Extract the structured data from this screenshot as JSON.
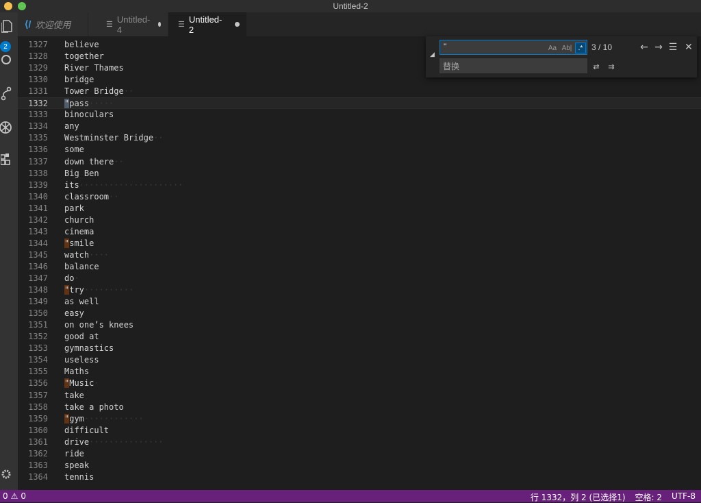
{
  "window": {
    "title": "Untitled-2"
  },
  "activity_bar": {
    "badge_count": "2"
  },
  "tabs": [
    {
      "label": "欢迎使用",
      "active": false
    },
    {
      "label": "Untitled-4",
      "active": false
    },
    {
      "label": "Untitled-2",
      "active": true
    }
  ],
  "editor": {
    "lines": [
      {
        "n": "1327",
        "text": "believe",
        "q": false,
        "ws": ""
      },
      {
        "n": "1328",
        "text": "together",
        "q": false,
        "ws": ""
      },
      {
        "n": "1329",
        "text": "River Thames",
        "q": false,
        "ws": ""
      },
      {
        "n": "1330",
        "text": "bridge",
        "q": false,
        "ws": ""
      },
      {
        "n": "1331",
        "text": "Tower Bridge",
        "q": false,
        "ws": "··"
      },
      {
        "n": "1332",
        "text": "pass",
        "q": true,
        "ws": "·····"
      },
      {
        "n": "1333",
        "text": "binoculars",
        "q": false,
        "ws": ""
      },
      {
        "n": "1334",
        "text": "any",
        "q": false,
        "ws": ""
      },
      {
        "n": "1335",
        "text": "Westminster Bridge",
        "q": false,
        "ws": "··"
      },
      {
        "n": "1336",
        "text": "some",
        "q": false,
        "ws": ""
      },
      {
        "n": "1337",
        "text": "down there",
        "q": false,
        "ws": "··"
      },
      {
        "n": "1338",
        "text": "Big Ben",
        "q": false,
        "ws": ""
      },
      {
        "n": "1339",
        "text": "its",
        "q": false,
        "ws": "·····················"
      },
      {
        "n": "1340",
        "text": "classroom",
        "q": false,
        "ws": "··"
      },
      {
        "n": "1341",
        "text": "park",
        "q": false,
        "ws": ""
      },
      {
        "n": "1342",
        "text": "church",
        "q": false,
        "ws": ""
      },
      {
        "n": "1343",
        "text": "cinema",
        "q": false,
        "ws": ""
      },
      {
        "n": "1344",
        "text": "smile",
        "q": true,
        "ws": ""
      },
      {
        "n": "1345",
        "text": "watch",
        "q": false,
        "ws": "····"
      },
      {
        "n": "1346",
        "text": "balance",
        "q": false,
        "ws": ""
      },
      {
        "n": "1347",
        "text": "do",
        "q": false,
        "ws": "·"
      },
      {
        "n": "1348",
        "text": "try",
        "q": true,
        "ws": "··········"
      },
      {
        "n": "1349",
        "text": "as well",
        "q": false,
        "ws": ""
      },
      {
        "n": "1350",
        "text": "easy",
        "q": false,
        "ws": ""
      },
      {
        "n": "1351",
        "text": "on one’s knees",
        "q": false,
        "ws": ""
      },
      {
        "n": "1352",
        "text": "good at",
        "q": false,
        "ws": ""
      },
      {
        "n": "1353",
        "text": "gymnastics",
        "q": false,
        "ws": ""
      },
      {
        "n": "1354",
        "text": "useless",
        "q": false,
        "ws": ""
      },
      {
        "n": "1355",
        "text": "Maths",
        "q": false,
        "ws": ""
      },
      {
        "n": "1356",
        "text": "Music",
        "q": true,
        "ws": "·"
      },
      {
        "n": "1357",
        "text": "take",
        "q": false,
        "ws": ""
      },
      {
        "n": "1358",
        "text": "take a photo",
        "q": false,
        "ws": ""
      },
      {
        "n": "1359",
        "text": "gym",
        "q": true,
        "ws": "············"
      },
      {
        "n": "1360",
        "text": "difficult",
        "q": false,
        "ws": ""
      },
      {
        "n": "1361",
        "text": "drive",
        "q": false,
        "ws": "···············"
      },
      {
        "n": "1362",
        "text": "ride",
        "q": false,
        "ws": ""
      },
      {
        "n": "1363",
        "text": "speak",
        "q": false,
        "ws": ""
      },
      {
        "n": "1364",
        "text": "tennis",
        "q": false,
        "ws": ""
      }
    ]
  },
  "find_widget": {
    "find_value": "\"",
    "match_case_label": "Aa",
    "whole_word_label": "Ab|",
    "regex_label": ".*",
    "match_count": "3 / 10",
    "replace_placeholder": "替换"
  },
  "status_bar": {
    "errors": "0",
    "warnings": "0",
    "position": "行 1332，列 2 (已选择1)",
    "indent": "空格: 2",
    "encoding": "UTF-8"
  },
  "colors": {
    "status_bar": "#68217a",
    "accent": "#007acc",
    "match_highlight": "#613214"
  }
}
